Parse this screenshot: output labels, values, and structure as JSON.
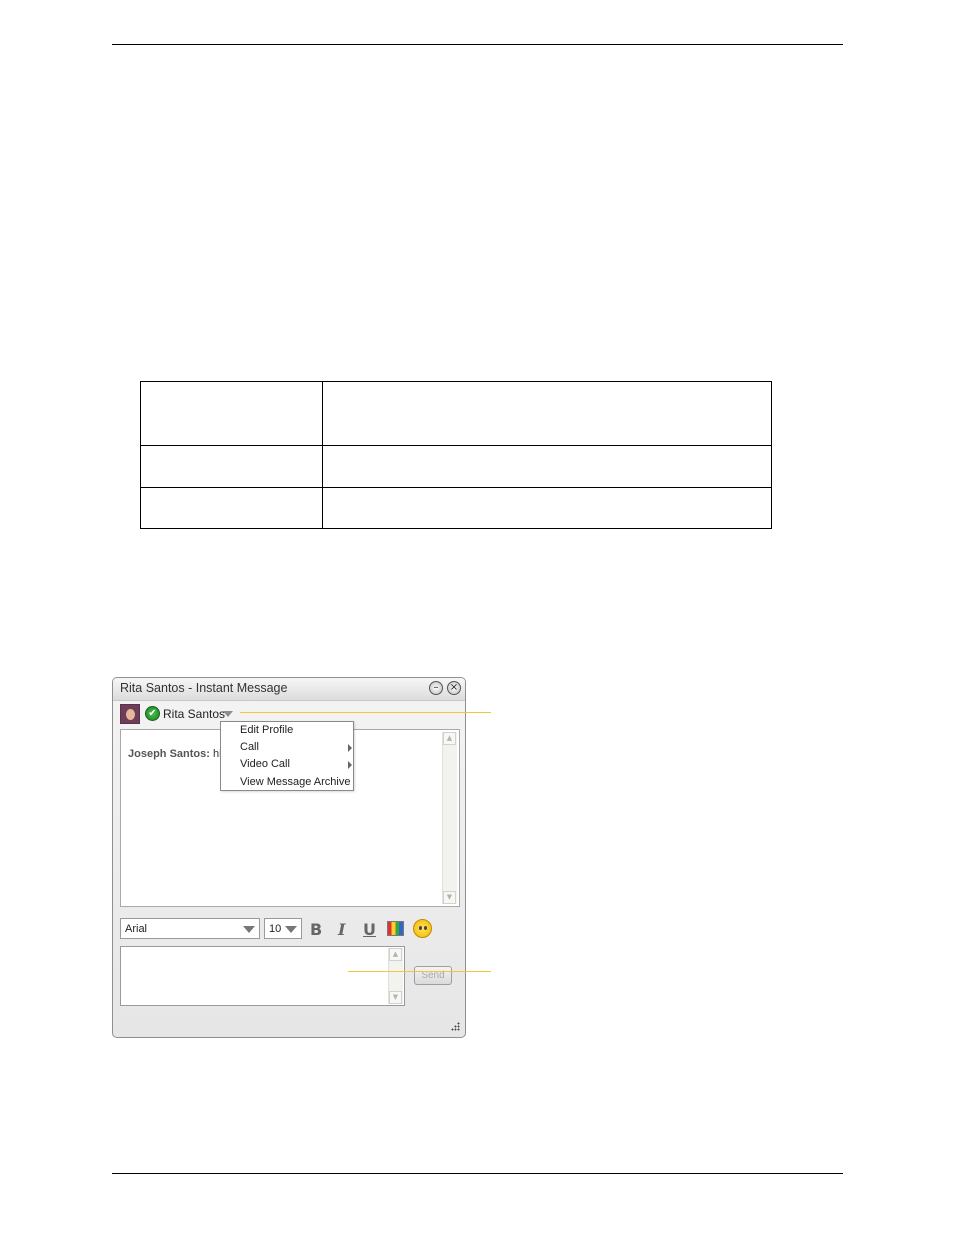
{
  "window": {
    "title": "Rita Santos - Instant Message",
    "minimize_glyph": "–",
    "close_glyph": "×"
  },
  "contact": {
    "name": "Rita Santos",
    "status_glyph": "✔"
  },
  "history": {
    "sender": "Joseph Santos:",
    "message": "hi"
  },
  "context_menu": {
    "items": [
      {
        "label": "Edit Profile",
        "submenu": false
      },
      {
        "label": "Call",
        "submenu": true
      },
      {
        "label": "Video Call",
        "submenu": true
      },
      {
        "label": "View Message Archive",
        "submenu": false
      }
    ]
  },
  "format_bar": {
    "font": "Arial",
    "size": "10",
    "bold_label": "B",
    "italic_label": "I",
    "underline_label": "U"
  },
  "compose": {
    "value": "",
    "send_label": "Send"
  },
  "icons": {
    "scroll_up": "▲",
    "scroll_down": "▼"
  },
  "colors": {
    "callout_line": "#f3c53a",
    "status_online": "#2b9a30"
  }
}
